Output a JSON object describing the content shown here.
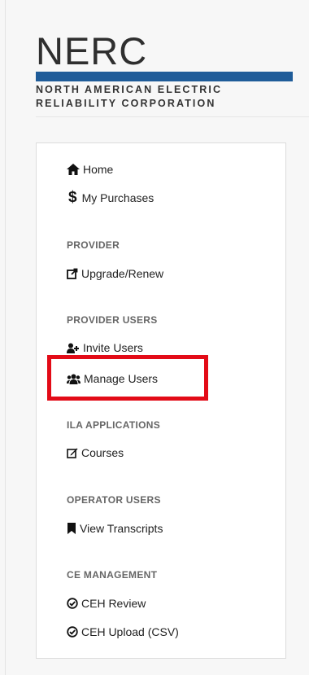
{
  "logo": {
    "word": "NERC",
    "line1": "NORTH AMERICAN ELECTRIC",
    "line2": "RELIABILITY CORPORATION"
  },
  "nav": {
    "home": "Home",
    "purchases": "My Purchases",
    "section_provider": "PROVIDER",
    "upgrade": "Upgrade/Renew",
    "section_provider_users": "PROVIDER USERS",
    "invite": "Invite Users",
    "manage": "Manage Users",
    "section_ila": "ILA APPLICATIONS",
    "courses": "Courses",
    "section_operator": "OPERATOR USERS",
    "transcripts": "View Transcripts",
    "section_ce": "CE MANAGEMENT",
    "ceh_review": "CEH Review",
    "ceh_upload": "CEH Upload (CSV)"
  },
  "icons": {
    "home": "home-icon",
    "purchases": "dollar-icon",
    "upgrade": "external-share-icon",
    "invite": "user-plus-icon",
    "manage": "users-icon",
    "courses": "edit-icon",
    "transcripts": "bookmark-icon",
    "ceh": "check-circle-icon"
  },
  "colors": {
    "highlight": "#e30b17",
    "logo_bar": "#1f5c99"
  }
}
